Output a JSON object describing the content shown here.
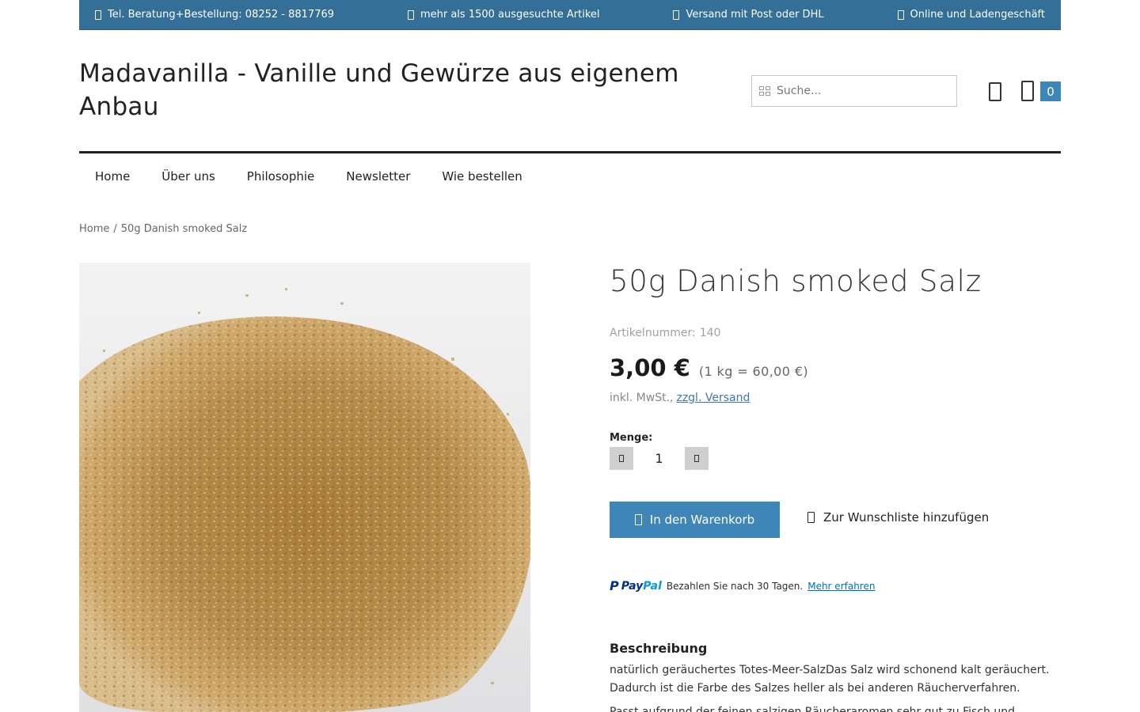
{
  "topbar": {
    "items": [
      {
        "icon": "phone-icon",
        "text": "Tel. Beratung+Bestellung: 08252 - 8817769"
      },
      {
        "icon": "box-icon",
        "text": "mehr als 1500 ausgesuchte Artikel"
      },
      {
        "icon": "truck-icon",
        "text": "Versand mit Post oder DHL"
      },
      {
        "icon": "store-icon",
        "text": "Online und Ladengeschäft"
      }
    ],
    "background_color": "#336f96"
  },
  "header": {
    "site_title": "Madavanilla - Vanille und Gewürze aus eigenem Anbau",
    "search_placeholder": "Suche...",
    "cart_count": "0"
  },
  "nav": {
    "items": [
      "Home",
      "Über uns",
      "Philosophie",
      "Newsletter",
      "Wie bestellen"
    ]
  },
  "breadcrumb": {
    "home": "Home",
    "separator": "/",
    "current": "50g Danish smoked Salz"
  },
  "product": {
    "title": "50g Danish smoked Salz",
    "sku_label": "Artikelnummer:",
    "sku_value": "140",
    "price": "3,00 €",
    "unit_price": "(1 kg = 60,00 €)",
    "tax_text": "inkl. MwSt.,",
    "shipping_link": "zzgl. Versand",
    "quantity_label": "Menge:",
    "quantity_value": "1",
    "add_to_cart_label": "In den Warenkorb",
    "wishlist_label": "Zur Wunschliste hinzufügen"
  },
  "paypal": {
    "logo_pay": "Pay",
    "logo_pal": "Pal",
    "message": "Bezahlen Sie nach 30 Tagen.",
    "link": "Mehr erfahren"
  },
  "description": {
    "heading": "Beschreibung",
    "paragraph_1": "natürlich geräuchertes Totes-Meer-SalzDas Salz wird schonend kalt geräuchert. Dadurch ist die Farbe des Salzes heller als bei anderen Räucherverfahren.",
    "paragraph_2": "Passt aufgrund der feinen salzigen Räucheraromen sehr gut zu Fisch und"
  },
  "colors": {
    "accent": "#3f86b8",
    "link": "#3b7aa7"
  }
}
